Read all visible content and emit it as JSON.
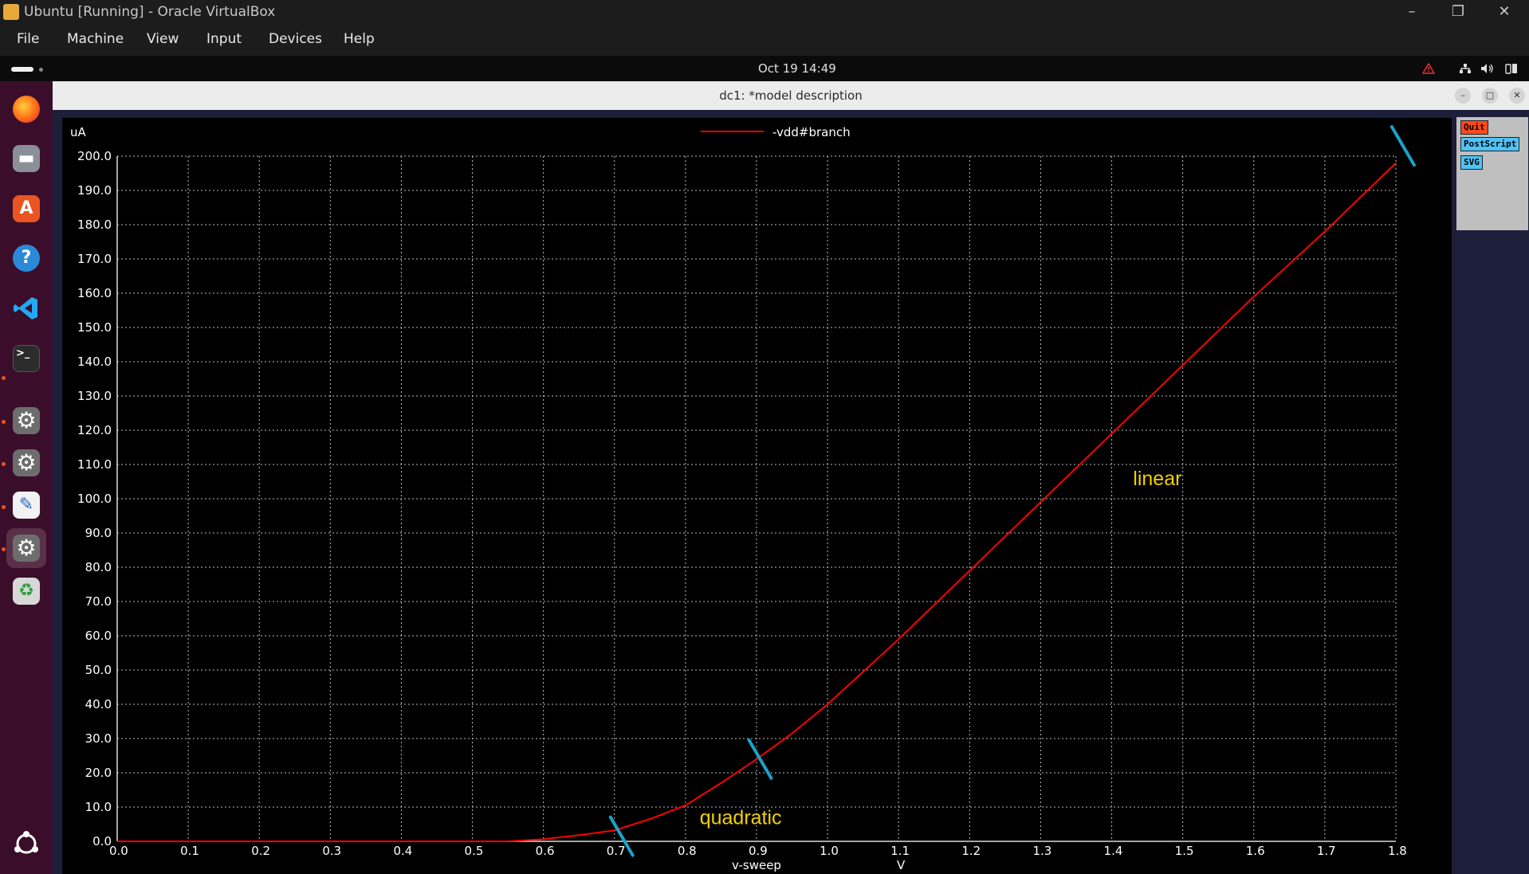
{
  "host_window": {
    "title": "Ubuntu [Running] - Oracle VirtualBox",
    "menu": [
      "File",
      "Machine",
      "View",
      "Input",
      "Devices",
      "Help"
    ]
  },
  "guest_panel": {
    "clock": "Oct 19  14:49"
  },
  "dock_items": [
    "firefox",
    "files",
    "app-center",
    "help",
    "vscode",
    "terminal",
    "settings",
    "settings",
    "text-editor",
    "settings",
    "trash",
    "show-apps"
  ],
  "plot_window": {
    "title": "dc1: *model description",
    "buttons": {
      "quit": "Quit",
      "postscript": "PostScript",
      "svg": "SVG"
    }
  },
  "chart_data": {
    "type": "line",
    "title": "",
    "xlabel": "v-sweep",
    "xunit": "V",
    "ylabel": "uA",
    "xlim": [
      0.0,
      1.8
    ],
    "ylim": [
      0.0,
      200.0
    ],
    "x_ticks": [
      "0.0",
      "0.1",
      "0.2",
      "0.3",
      "0.4",
      "0.5",
      "0.6",
      "0.7",
      "0.8",
      "0.9",
      "1.0",
      "1.1",
      "1.2",
      "1.3",
      "1.4",
      "1.5",
      "1.6",
      "1.7",
      "1.8"
    ],
    "y_ticks": [
      "0.0",
      "10.0",
      "20.0",
      "30.0",
      "40.0",
      "50.0",
      "60.0",
      "70.0",
      "80.0",
      "90.0",
      "100.0",
      "110.0",
      "120.0",
      "130.0",
      "140.0",
      "150.0",
      "160.0",
      "170.0",
      "180.0",
      "190.0",
      "200.0"
    ],
    "grid": true,
    "legend_position": "top-center",
    "series": [
      {
        "name": "-vdd#branch",
        "color": "#ff0000",
        "x": [
          0.0,
          0.55,
          0.6,
          0.65,
          0.7,
          0.75,
          0.8,
          0.85,
          0.9,
          0.95,
          1.0,
          1.1,
          1.2,
          1.3,
          1.4,
          1.5,
          1.6,
          1.7,
          1.8
        ],
        "y": [
          0.0,
          0.0,
          0.6,
          1.8,
          3.2,
          6.5,
          10.5,
          17.0,
          24.0,
          31.5,
          40.0,
          59.0,
          79.0,
          99.0,
          119.0,
          139.0,
          159.0,
          178.0,
          198.0
        ]
      }
    ],
    "annotations": [
      {
        "text": "quadratic",
        "color": "#f2d000",
        "at": [
          0.82,
          5.0
        ]
      },
      {
        "text": "linear",
        "color": "#f2d000",
        "at": [
          1.43,
          104.0
        ]
      }
    ],
    "markers": [
      {
        "color": "#1aa3c8",
        "at": [
          0.71,
          1.5
        ]
      },
      {
        "color": "#1aa3c8",
        "at": [
          0.905,
          24.0
        ]
      },
      {
        "color": "#1aa3c8",
        "at": [
          1.81,
          203.0
        ]
      }
    ]
  }
}
